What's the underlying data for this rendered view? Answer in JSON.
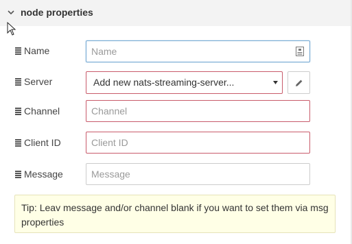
{
  "section": {
    "title": "node properties",
    "chevron_icon": "chevron-down-icon"
  },
  "form": {
    "name": {
      "label": "Name",
      "placeholder": "Name",
      "icon": "document-icon"
    },
    "server": {
      "label": "Server",
      "selected": "Add new nats-streaming-server...",
      "edit_icon": "pencil-icon"
    },
    "channel": {
      "label": "Channel",
      "placeholder": "Channel"
    },
    "client_id": {
      "label": "Client ID",
      "placeholder": "Client ID"
    },
    "message": {
      "label": "Message",
      "placeholder": "Message"
    },
    "label_icon": "list-icon"
  },
  "tip": {
    "text": "Tip: Leav message and/or channel blank if you want to set them via msg properties"
  },
  "colors": {
    "invalid_border": "#c85a6a",
    "focus_border": "#74a8d3",
    "tip_background": "#ffffe6"
  }
}
